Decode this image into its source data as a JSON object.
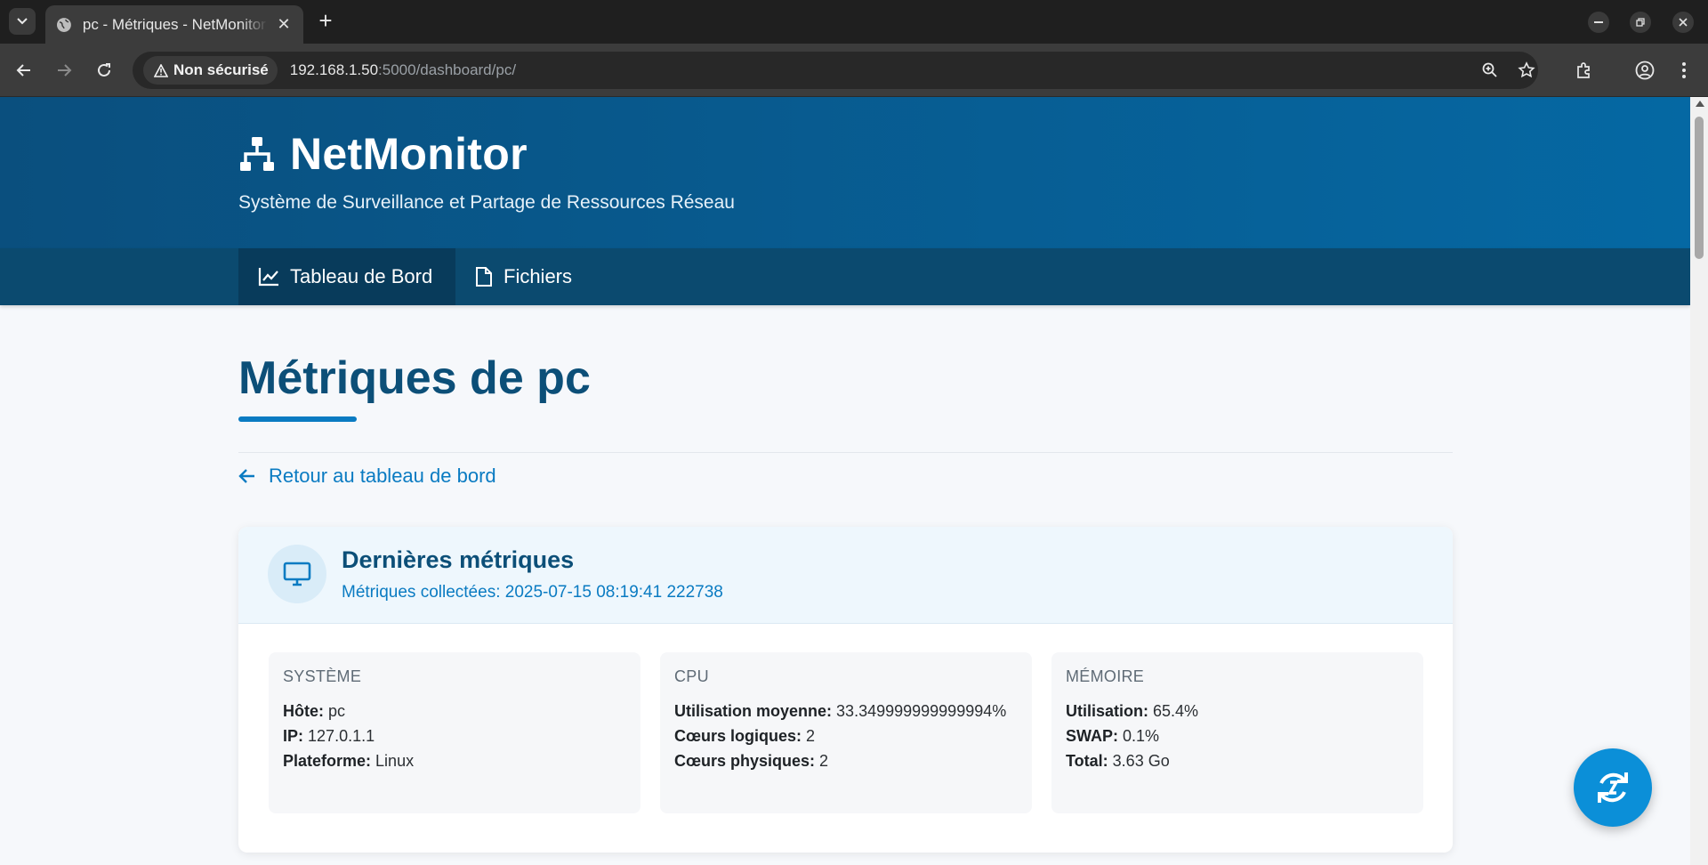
{
  "browser": {
    "tab_title": "pc - Métriques - NetMonitor",
    "security_label": "Non sécurisé",
    "url_host": "192.168.1.50",
    "url_rest": ":5000/dashboard/pc/"
  },
  "header": {
    "brand": "NetMonitor",
    "subtitle": "Système de Surveillance et Partage de Ressources Réseau"
  },
  "nav": {
    "items": [
      {
        "label": "Tableau de Bord",
        "icon": "chart-line-icon",
        "active": true
      },
      {
        "label": "Fichiers",
        "icon": "file-icon",
        "active": false
      }
    ]
  },
  "main": {
    "title": "Métriques de pc",
    "back_link": "Retour au tableau de bord"
  },
  "card": {
    "title": "Dernières métriques",
    "subtitle": "Métriques collectées: 2025-07-15 08:19:41 222738",
    "panels": [
      {
        "title": "SYSTÈME",
        "rows": [
          {
            "label": "Hôte:",
            "value": "pc"
          },
          {
            "label": "IP:",
            "value": "127.0.1.1"
          },
          {
            "label": "Plateforme:",
            "value": "Linux"
          }
        ]
      },
      {
        "title": "CPU",
        "rows": [
          {
            "label": "Utilisation moyenne:",
            "value": "33.349999999999994%"
          },
          {
            "label": "Cœurs logiques:",
            "value": "2"
          },
          {
            "label": "Cœurs physiques:",
            "value": "2"
          }
        ]
      },
      {
        "title": "MÉMOIRE",
        "rows": [
          {
            "label": "Utilisation:",
            "value": "65.4%"
          },
          {
            "label": "SWAP:",
            "value": "0.1%"
          },
          {
            "label": "Total:",
            "value": "3.63 Go"
          }
        ]
      }
    ]
  },
  "colors": {
    "header_start": "#0a4f7e",
    "header_end": "#0568a3",
    "nav_bg": "#0b4a6f",
    "accent": "#0a7bc2",
    "fab": "#0b8fd8"
  }
}
